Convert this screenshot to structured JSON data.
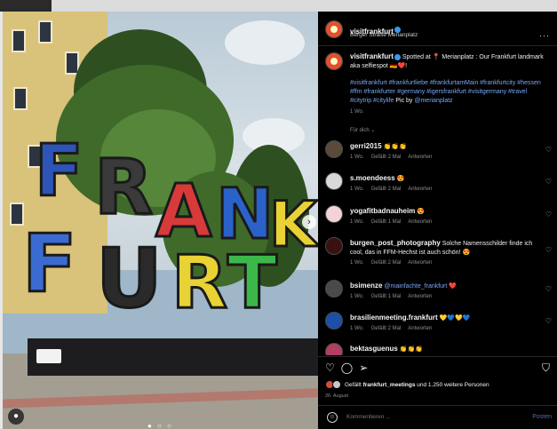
{
  "post": {
    "author": "visitfrankfurt",
    "location": "Berger Straße Merianplatz",
    "more_icon": "more-horizontal-icon"
  },
  "caption": {
    "author": "visitfrankfurt",
    "text_1": " Spotted at 📍 Merianplatz : Our Frankfurt landmark aka selfiespot 🇩🇪❤️!",
    "hashtags": "#visitfrankfurt #frankfurtliebe #frankfurtamMain #frankfurtcity #hessen #ffm #frankfurter #germany #igersfrankfurt #visitgermany #travel #citytrip #citylife",
    "credit_prefix": "Pic by ",
    "credit_handle": "@merianplatz",
    "age": "1 Wo.",
    "translate": "Für dich ⌄"
  },
  "comments": [
    {
      "user": "gerri2015",
      "text": "👏👏👏",
      "age": "1 Wo.",
      "likes": "Gefällt 2 Mal",
      "reply": "Antworten",
      "avatar_color": "#5a4a3a"
    },
    {
      "user": "s.moendeess",
      "text": "😍",
      "age": "1 Wo.",
      "likes": "Gefällt 2 Mal",
      "reply": "Antworten",
      "avatar_color": "#d9d9d9"
    },
    {
      "user": "yogafitbadnauheim",
      "text": "😍",
      "age": "1 Wo.",
      "likes": "Gefällt 1 Mal",
      "reply": "Antworten",
      "avatar_color": "#f2d3d8"
    },
    {
      "user": "burgen_post_photography",
      "text": "Solche Namensschilder finde ich cool, das in FFM-Hechst ist auch schön! 😍",
      "age": "1 Wo.",
      "likes": "Gefällt 2 Mal",
      "reply": "Antworten",
      "avatar_color": "#3a1010"
    },
    {
      "user": "bsimenze",
      "text": "@mainfachte_frankfurt ❤️",
      "age": "1 Wo.",
      "likes": "Gefällt 1 Mal",
      "reply": "Antworten",
      "avatar_color": "#4a4a4a"
    },
    {
      "user": "brasilienmeeting.frankfurt",
      "text": "💛💙💛💙",
      "age": "1 Wo.",
      "likes": "Gefällt 2 Mal",
      "reply": "Antworten",
      "avatar_color": "#1b4fa8"
    },
    {
      "user": "bektasguenus",
      "text": "👏👏👏",
      "age": "",
      "likes": "",
      "reply": "",
      "avatar_color": "#b04060"
    }
  ],
  "actions": {
    "like_icon": "heart-icon",
    "comment_icon": "comment-icon",
    "share_icon": "send-icon",
    "save_icon": "bookmark-icon"
  },
  "likes": {
    "prefix": "Gefällt ",
    "user": "frankfurt_meetings",
    "suffix": " und 1.250 weitere Personen"
  },
  "date": "26. August",
  "comment_box": {
    "placeholder": "Kommentieren ...",
    "post_label": "Posten"
  },
  "sign_letters": [
    "F",
    "R",
    "A",
    "N",
    "K",
    "F",
    "U",
    "R",
    "T"
  ]
}
